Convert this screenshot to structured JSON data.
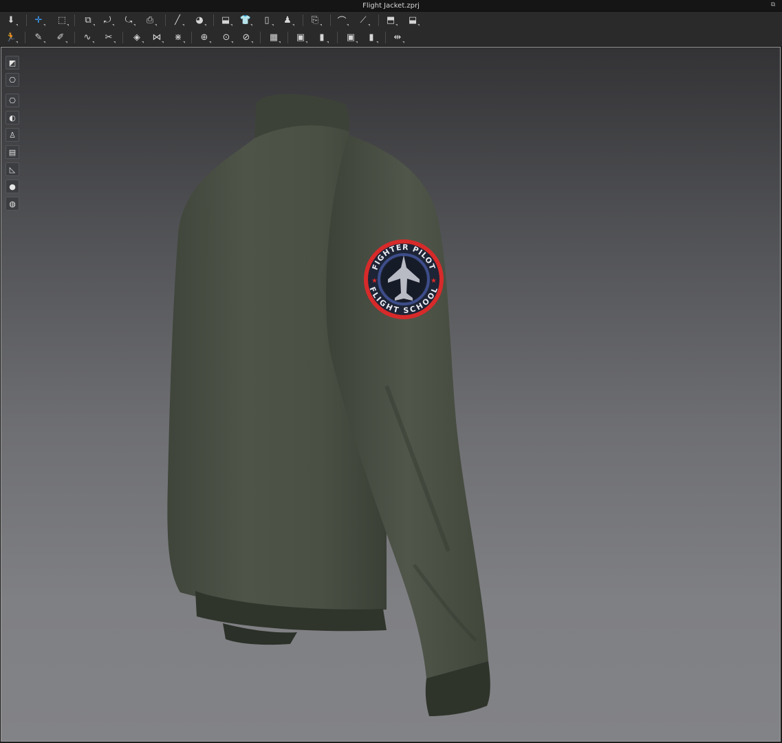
{
  "window": {
    "title": "Flight Jacket.zprj"
  },
  "toolbar_row1": [
    {
      "name": "simulation-icon",
      "glyph": "⬇"
    },
    {
      "name": "transform-pattern-icon",
      "glyph": "✛"
    },
    {
      "name": "select-mesh-icon",
      "glyph": "⬚"
    },
    {
      "name": "edit-pattern-icon",
      "glyph": "⧉"
    },
    {
      "name": "rotate-pattern-icon",
      "glyph": "⤾"
    },
    {
      "name": "reset-pattern-icon",
      "glyph": "⤿"
    },
    {
      "name": "camera-icon",
      "glyph": "⎙"
    },
    {
      "name": "pin-icon",
      "glyph": "╱"
    },
    {
      "name": "tack-icon",
      "glyph": "◕"
    },
    {
      "name": "arrangement-icon",
      "glyph": "⬓"
    },
    {
      "name": "shirt-front-icon",
      "glyph": "👕"
    },
    {
      "name": "shirt-side-icon",
      "glyph": "▯"
    },
    {
      "name": "avatar-shirt-icon",
      "glyph": "♟"
    },
    {
      "name": "fold-icon",
      "glyph": "⎘"
    },
    {
      "name": "measure-curve-icon",
      "glyph": "⌒"
    },
    {
      "name": "measure-line-icon",
      "glyph": "⟋"
    },
    {
      "name": "garment-fit-icon",
      "glyph": "⬒"
    },
    {
      "name": "garment-layer-icon",
      "glyph": "⬓"
    }
  ],
  "toolbar_row2": [
    {
      "name": "avatar-pose-icon",
      "glyph": "🏃"
    },
    {
      "name": "edit-texture-icon",
      "glyph": "✎"
    },
    {
      "name": "brush-icon",
      "glyph": "✐"
    },
    {
      "name": "curve-edit-icon",
      "glyph": "∿"
    },
    {
      "name": "cut-icon",
      "glyph": "✂"
    },
    {
      "name": "graphic-icon",
      "glyph": "◈"
    },
    {
      "name": "topstitch-icon",
      "glyph": "⋈"
    },
    {
      "name": "puckering-icon",
      "glyph": "⋇"
    },
    {
      "name": "button-icon",
      "glyph": "⊕"
    },
    {
      "name": "buttonhole-icon",
      "glyph": "⊙"
    },
    {
      "name": "zipper-icon",
      "glyph": "⊘"
    },
    {
      "name": "trim-icon",
      "glyph": "▦"
    },
    {
      "name": "fabric-cube-icon",
      "glyph": "▣"
    },
    {
      "name": "fabric-panel-icon",
      "glyph": "▮"
    },
    {
      "name": "texture-cube-icon",
      "glyph": "▣"
    },
    {
      "name": "texture-panel-icon",
      "glyph": "▮"
    },
    {
      "name": "strengthen-icon",
      "glyph": "⇹"
    }
  ],
  "side_tools": [
    {
      "name": "fabric-view-icon",
      "glyph": "◩"
    },
    {
      "name": "garment-view-icon",
      "glyph": "⎔"
    },
    {
      "name": "show-garment-icon",
      "glyph": "⎔"
    },
    {
      "name": "show-avatar-icon",
      "glyph": "◐"
    },
    {
      "name": "avatar-body-icon",
      "glyph": "♙"
    },
    {
      "name": "surface-icon",
      "glyph": "▤"
    },
    {
      "name": "shoe-icon",
      "glyph": "◺"
    },
    {
      "name": "skin-icon",
      "glyph": "●"
    },
    {
      "name": "environment-icon",
      "glyph": "◍"
    }
  ],
  "patch": {
    "top_text": "FIGHTER PILOT",
    "bottom_text": "FLIGHT SCHOOL",
    "ring_color": "#d72a2a",
    "inner_color": "#1d2436",
    "band_color": "#3d4d8a"
  },
  "colors": {
    "jacket": "#4b5145",
    "jacket_dark": "#343a30",
    "rib": "#2f342b"
  }
}
